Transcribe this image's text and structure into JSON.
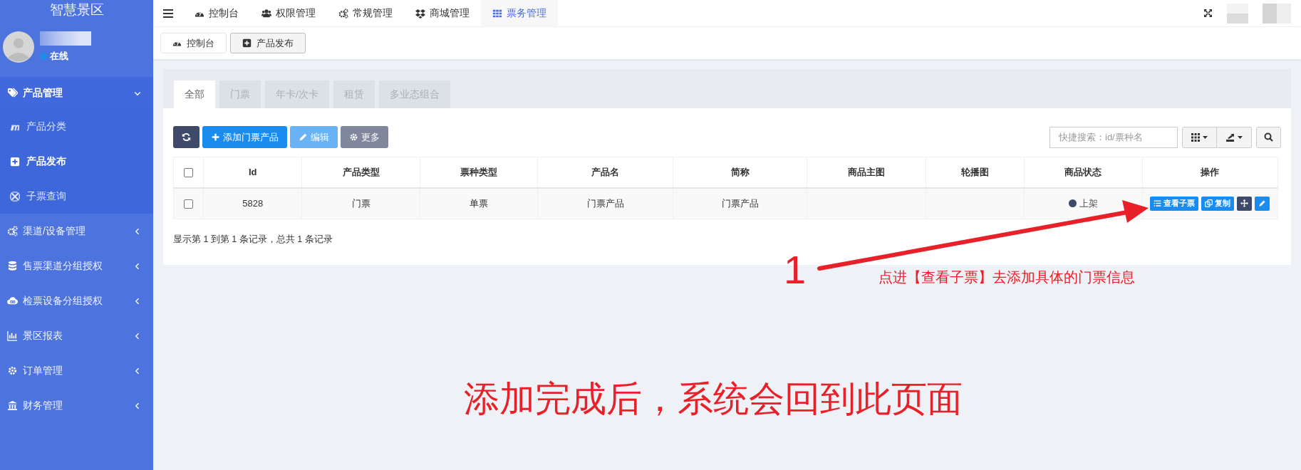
{
  "sidebar": {
    "title": "智慧景区",
    "user": {
      "status": "在线",
      "online": true
    },
    "menu": [
      {
        "label": "产品管理",
        "expanded": true,
        "children": [
          {
            "label": "产品分类",
            "selected": false
          },
          {
            "label": "产品发布",
            "selected": true
          },
          {
            "label": "子票查询",
            "selected": false
          }
        ]
      },
      {
        "label": "渠道/设备管理",
        "expanded": false
      },
      {
        "label": "售票渠道分组授权",
        "expanded": false
      },
      {
        "label": "检票设备分组授权",
        "expanded": false
      },
      {
        "label": "景区报表",
        "expanded": false
      },
      {
        "label": "订单管理",
        "expanded": false
      },
      {
        "label": "财务管理",
        "expanded": false
      }
    ]
  },
  "top_nav": {
    "items": [
      {
        "label": "控制台",
        "selected": false
      },
      {
        "label": "权限管理",
        "selected": false
      },
      {
        "label": "常规管理",
        "selected": false
      },
      {
        "label": "商城管理",
        "selected": false
      },
      {
        "label": "票务管理",
        "selected": true
      }
    ]
  },
  "page_tabs": [
    {
      "label": "控制台",
      "selected": false
    },
    {
      "label": "产品发布",
      "selected": true
    }
  ],
  "panel": {
    "tabs": [
      {
        "label": "全部",
        "selected": true
      },
      {
        "label": "门票",
        "selected": false
      },
      {
        "label": "年卡/次卡",
        "selected": false
      },
      {
        "label": "租赁",
        "selected": false
      },
      {
        "label": "多业态组合",
        "selected": false
      }
    ],
    "toolbar": [
      {
        "kind": "refresh",
        "disabled": false
      },
      {
        "kind": "add",
        "label": "添加门票产品",
        "disabled": false
      },
      {
        "kind": "edit",
        "label": "编辑",
        "disabled": true
      },
      {
        "kind": "more",
        "label": "更多",
        "disabled": false
      }
    ],
    "search": {
      "placeholder": "快捷搜索：id/票种名"
    },
    "table": {
      "select_all_checked": false,
      "columns": [
        "Id",
        "产品类型",
        "票种类型",
        "产品名",
        "简称",
        "商品主图",
        "轮播图",
        "商品状态",
        "操作"
      ],
      "rows": [
        {
          "checked": false,
          "cells": [
            "5828",
            "门票",
            "单票",
            "门票产品",
            "门票产品",
            "",
            ""
          ],
          "status": {
            "label": "上架",
            "color": "#3d4a6b"
          },
          "actions": [
            {
              "kind": "text",
              "label": "查看子票"
            },
            {
              "kind": "text",
              "label": "复制"
            },
            {
              "kind": "move"
            },
            {
              "kind": "edit"
            }
          ]
        }
      ]
    },
    "footer": "显示第 1 到第 1 条记录，总共 1 条记录"
  },
  "annotations": {
    "step": "1",
    "note": "点进【查看子票】去添加具体的门票信息",
    "caption": "添加完成后，系统会回到此页面"
  }
}
